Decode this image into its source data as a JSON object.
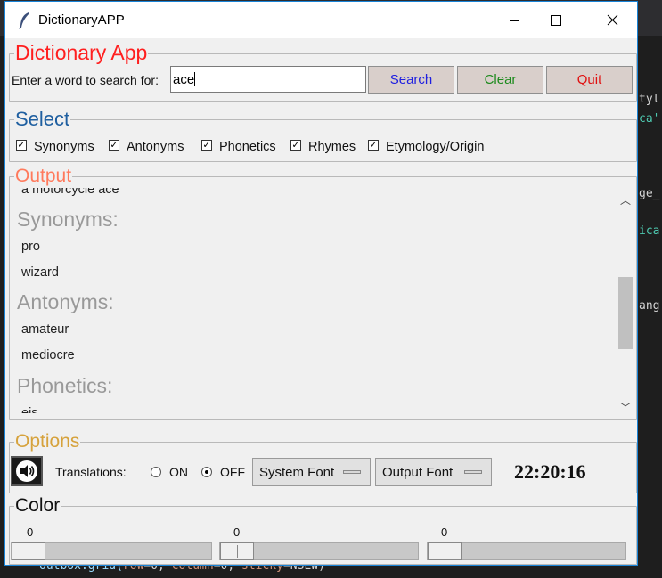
{
  "window": {
    "title": "DictionaryAPP"
  },
  "app": {
    "title": "Dictionary App",
    "search_prompt": "Enter a word to search for:",
    "search_value": "ace",
    "buttons": {
      "search": "Search",
      "clear": "Clear",
      "quit": "Quit"
    }
  },
  "select": {
    "title": "Select",
    "options": [
      {
        "label": "Synonyms",
        "checked": true
      },
      {
        "label": "Antonyms",
        "checked": true
      },
      {
        "label": "Phonetics",
        "checked": true
      },
      {
        "label": "Rhymes",
        "checked": true
      },
      {
        "label": "Etymology/Origin",
        "checked": true
      }
    ]
  },
  "output": {
    "title": "Output",
    "clipped_top_line": "a motorcycle ace",
    "synonyms_heading": "Synonyms:",
    "synonyms": [
      "pro",
      "wizard"
    ],
    "antonyms_heading": "Antonyms:",
    "antonyms": [
      "amateur",
      "mediocre"
    ],
    "phonetics_heading": "Phonetics:",
    "clipped_bottom_line": "eis"
  },
  "options": {
    "title": "Options",
    "translations_label": "Translations:",
    "on_label": "ON",
    "off_label": "OFF",
    "translations_selected": "OFF",
    "system_font": "System Font",
    "output_font": "Output Font",
    "clock": "22:20:16"
  },
  "color": {
    "title": "Color",
    "sliders": [
      {
        "value": "0"
      },
      {
        "value": "0"
      },
      {
        "value": "0"
      }
    ]
  },
  "colors": {
    "app_title": "#ff1f1f",
    "select_title": "#1f5fa0",
    "output_title": "#ff7a5c",
    "options_title": "#d6a23c",
    "color_title": "#111111",
    "search_btn": "#2020e0",
    "clear_btn": "#1d8a1d",
    "quit_btn": "#e01010"
  },
  "background_editor": {
    "bottom_line": {
      "a": "outbox.grid(",
      "b": "row",
      "c": "=0, ",
      "d": "column",
      "e": "=0, ",
      "f": "sticky",
      "g": "=NSEW)"
    },
    "right_fragments": [
      "tyl",
      "ca'",
      "ge_",
      "ica",
      "ang"
    ]
  }
}
